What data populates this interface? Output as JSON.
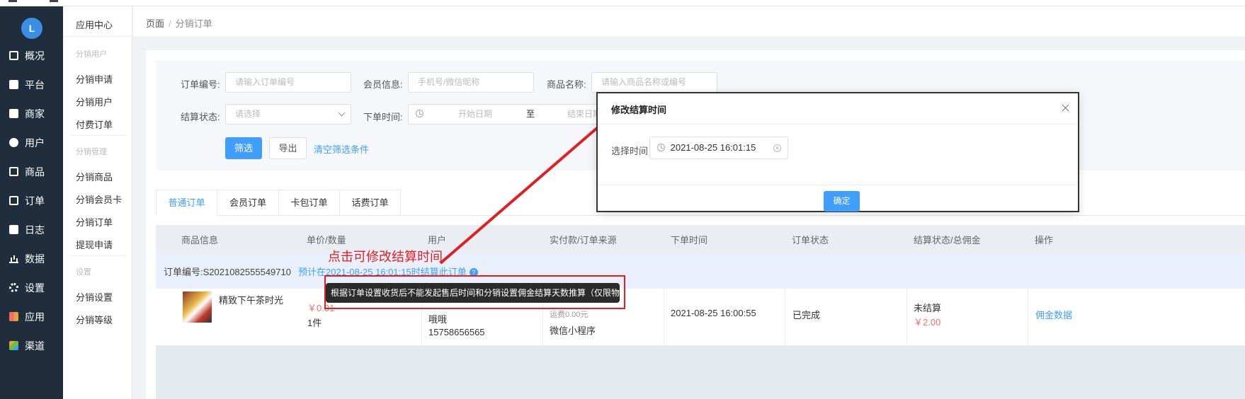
{
  "sidebar": {
    "logo_text": "L",
    "items": [
      {
        "label": "概况",
        "icon": "chart-icon"
      },
      {
        "label": "平台",
        "icon": "monitor-icon"
      },
      {
        "label": "商家",
        "icon": "store-icon"
      },
      {
        "label": "用户",
        "icon": "user-icon"
      },
      {
        "label": "商品",
        "icon": "goods-icon"
      },
      {
        "label": "订单",
        "icon": "order-icon"
      },
      {
        "label": "日志",
        "icon": "log-icon"
      },
      {
        "label": "数据",
        "icon": "bar-chart-icon"
      },
      {
        "label": "设置",
        "icon": "gear-icon"
      },
      {
        "label": "应用",
        "icon": "apps-icon"
      },
      {
        "label": "渠道",
        "icon": "cube-icon"
      }
    ]
  },
  "subnav": {
    "title": "应用中心",
    "groups": [
      {
        "label": "分销用户",
        "items": [
          "分销申请",
          "分销用户",
          "付费订单"
        ]
      },
      {
        "label": "分销管理",
        "items": [
          "分销商品",
          "分销会员卡",
          "分销订单",
          "提现申请"
        ]
      },
      {
        "label": "设置",
        "items": [
          "分销设置",
          "分销等级"
        ]
      }
    ]
  },
  "breadcrumb": {
    "root": "页面",
    "sep": "/",
    "current": "分销订单"
  },
  "filter": {
    "order_no_label": "订单编号:",
    "order_no_placeholder": "请输入订单编号",
    "member_label": "会员信息:",
    "member_placeholder": "手机号/微信昵称",
    "goods_label": "商品名称:",
    "goods_placeholder": "请输入商品名称或编号",
    "settle_status_label": "结算状态:",
    "settle_status_placeholder": "请选择",
    "order_time_label": "下单时间:",
    "start_placeholder": "开始日期",
    "range_sep": "至",
    "end_placeholder": "结束日期",
    "filter_button": "筛选",
    "export_button": "导出",
    "clear_link": "清空筛选条件"
  },
  "tabs": [
    "普通订单",
    "会员订单",
    "卡包订单",
    "话费订单"
  ],
  "table": {
    "headers": [
      "商品信息",
      "单价/数量",
      "用户",
      "实付款/订单来源",
      "下单时间",
      "订单状态",
      "结算状态/总佣金",
      "操作"
    ],
    "order": {
      "order_no": "订单编号:S2021082555549710",
      "settle_text": "预计在2021-08-25 16:01:15时结算此订单",
      "goods_name": "精致下午茶时光",
      "price": "￥0.01",
      "quantity": "1件",
      "user_name": "哦哦",
      "user_phone": "15758656565",
      "shipping": "运费0.00元",
      "source": "微信小程序",
      "order_time": "2021-08-25 16:00:55",
      "status": "已完成",
      "settle_status": "未结算",
      "commission": "￥2.00",
      "action": "佣金数据"
    }
  },
  "tooltip": "根据订单设置收货后不能发起售后时间和分销设置佣金结算天数推算（仅限物流订单）",
  "annotation": "点击可修改结算时间",
  "dialog": {
    "title": "修改结算时间",
    "label": "选择时间",
    "value": "2021-08-25 16:01:15",
    "confirm": "确定"
  },
  "colors": {
    "primary": "#409eff",
    "sidebar": "#1f2d3d",
    "annotation": "#e02020",
    "price": "#f56c6c"
  }
}
